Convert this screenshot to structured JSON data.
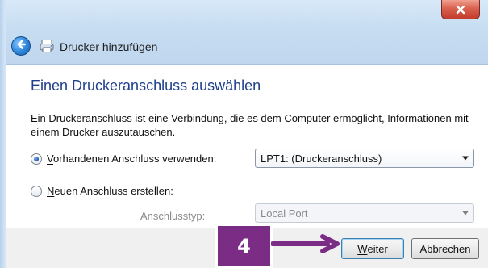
{
  "window": {
    "title": "Drucker hinzufügen",
    "back_icon": "back-arrow-icon",
    "printer_icon": "printer-icon",
    "close_icon": "close-icon"
  },
  "page": {
    "heading": "Einen Druckeranschluss auswählen",
    "description": "Ein Druckeranschluss ist eine Verbindung, die es dem Computer ermöglicht, Informationen mit einem Drucker auszutauschen."
  },
  "options": {
    "existing": {
      "label_first": "V",
      "label_rest": "orhandenen Anschluss verwenden:",
      "selected": true,
      "value": "LPT1: (Druckeranschluss)"
    },
    "new": {
      "label_first": "N",
      "label_rest": "euen Anschluss erstellen:",
      "selected": false,
      "port_type_label": "Anschlusstyp:",
      "port_type_value": "Local Port"
    }
  },
  "buttons": {
    "next_first": "W",
    "next_rest": "eiter",
    "cancel": "Abbrechen"
  },
  "annotation": {
    "step": "4",
    "color": "#7b2d86"
  }
}
